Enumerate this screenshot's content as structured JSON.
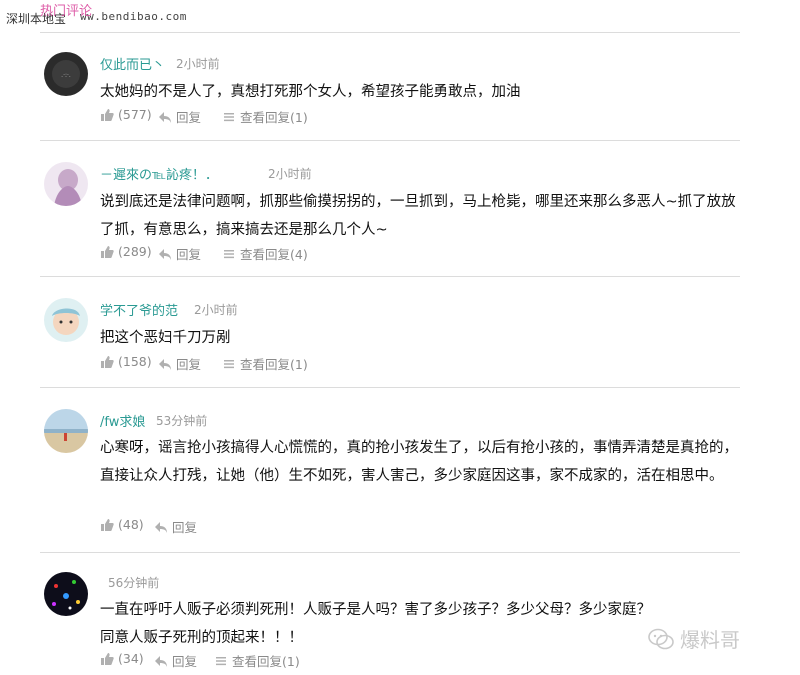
{
  "header": {
    "site_label": "深圳本地宝",
    "site_url": "ww.bendibao.com",
    "stamp": "热门评论"
  },
  "comments": [
    {
      "username": "仅此而已丶",
      "time": "2小时前",
      "text": "太她妈的不是人了，真想打死那个女人，希望孩子能勇敢点，加油",
      "likes": "(577)",
      "reply_label": "回复",
      "view_replies_label": "查看回复(1)"
    },
    {
      "username": "－遲來の℡訫疼！．",
      "time": "2小时前",
      "text": "说到底还是法律问题啊，抓那些偷摸拐拐的，一旦抓到，马上枪毙，哪里还来那么多恶人~抓了放放了抓，有意思么，搞来搞去还是那么几个人~",
      "likes": "(289)",
      "reply_label": "回复",
      "view_replies_label": "查看回复(4)"
    },
    {
      "username": "学不了爷的范",
      "time": "2小时前",
      "text": "把这个恶妇千刀万剐",
      "likes": "(158)",
      "reply_label": "回复",
      "view_replies_label": "查看回复(1)"
    },
    {
      "username": "/fw求娘",
      "time": "53分钟前",
      "text": "心寒呀，谣言抢小孩搞得人心慌慌的，真的抢小孩发生了，以后有抢小孩的，事情弄清楚是真抢的，直接让众人打残，让她（他）生不如死，害人害己，多少家庭因这事，家不成家的，活在相思中。",
      "likes": "(48)",
      "reply_label": "回复"
    },
    {
      "username": "",
      "time": "56分钟前",
      "text": "一直在呼吁人贩子必须判死刑！人贩子是人吗？害了多少孩子？多少父母？多少家庭？同意人贩子死刑的顶起来！！！",
      "likes": "(34)",
      "reply_label": "回复",
      "view_replies_label": "查看回复(1)"
    }
  ],
  "watermark": {
    "text": "爆料哥"
  },
  "colors": {
    "username": "#2a9a93",
    "meta": "#9a9a9a",
    "divider": "#dcdcdc"
  }
}
